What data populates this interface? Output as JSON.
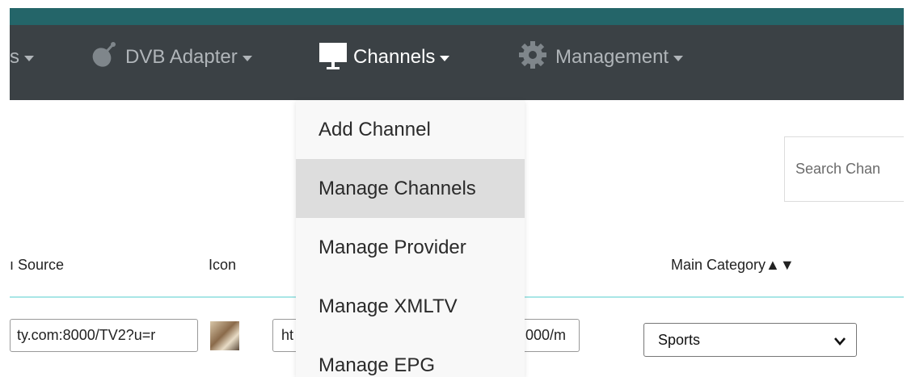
{
  "nav": {
    "items": [
      {
        "label": "s",
        "icon": "none",
        "active": false
      },
      {
        "label": "DVB Adapter",
        "icon": "satellite-dish-icon",
        "active": false
      },
      {
        "label": "Channels",
        "icon": "monitor-icon",
        "active": true
      },
      {
        "label": "Management",
        "icon": "gear-icon",
        "active": false
      }
    ]
  },
  "dropdown": {
    "items": [
      {
        "label": "Add Channel"
      },
      {
        "label": "Manage Channels",
        "highlighted": true
      },
      {
        "label": "Manage Provider"
      },
      {
        "label": "Manage XMLTV"
      },
      {
        "label": "Manage EPG"
      }
    ]
  },
  "search": {
    "placeholder": "Search Chan"
  },
  "table": {
    "headers": {
      "source": "ı Source",
      "icon": "Icon",
      "main_category": "Main Category▲▼"
    },
    "row": {
      "source_value": "ty.com:8000/TV2?u=r",
      "epg_value_left": "ht",
      "epg_value_right": "000/m",
      "main_category": "Sports"
    }
  },
  "colors": {
    "accent_bar": "#246569",
    "navbar": "#3b4145",
    "header_rule": "#a9e6e6",
    "dropdown_bg": "#f8f8f8",
    "dropdown_hover": "#dddddd"
  }
}
